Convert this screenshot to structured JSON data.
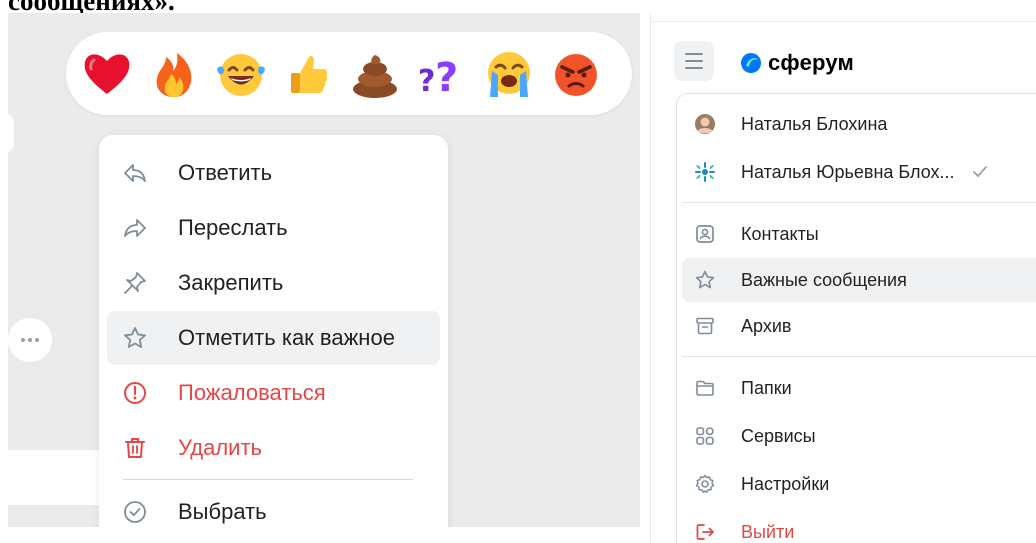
{
  "heading": {
    "text": "сообщениях»."
  },
  "reactions": [
    {
      "icon": "heart-emoji-icon"
    },
    {
      "icon": "fire-emoji-icon"
    },
    {
      "icon": "laughing-tears-emoji-icon"
    },
    {
      "icon": "thumbs-up-emoji-icon"
    },
    {
      "icon": "poop-emoji-icon"
    },
    {
      "icon": "question-marks-emoji-icon"
    },
    {
      "icon": "crying-face-emoji-icon"
    },
    {
      "icon": "angry-face-emoji-icon"
    }
  ],
  "context_menu": {
    "items": [
      {
        "label": "Ответить",
        "icon": "reply-icon"
      },
      {
        "label": "Переслать",
        "icon": "forward-icon"
      },
      {
        "label": "Закрепить",
        "icon": "pin-icon"
      },
      {
        "label": "Отметить как важное",
        "icon": "star-icon",
        "highlighted": true
      },
      {
        "label": "Пожаловаться",
        "icon": "report-icon",
        "danger": true
      },
      {
        "label": "Удалить",
        "icon": "trash-icon",
        "danger": true
      },
      {
        "label": "Выбрать",
        "icon": "check-circle-icon"
      }
    ]
  },
  "app": {
    "logo_text": "сферум"
  },
  "side_menu": {
    "accounts": [
      {
        "name": "Наталья Блохина",
        "icon": "user-avatar"
      },
      {
        "name": "Наталья Юрьевна Блох...",
        "icon": "organization-logo",
        "selected": true
      }
    ],
    "items": [
      {
        "label": "Контакты",
        "icon": "contacts-icon"
      },
      {
        "label": "Важные сообщения",
        "icon": "star-icon",
        "highlighted": true
      },
      {
        "label": "Архив",
        "icon": "archive-icon"
      },
      {
        "label": "Папки",
        "icon": "folder-icon"
      },
      {
        "label": "Сервисы",
        "icon": "services-icon"
      },
      {
        "label": "Настройки",
        "icon": "settings-icon"
      },
      {
        "label": "Выйти",
        "icon": "logout-icon",
        "danger": true
      }
    ]
  },
  "colors": {
    "accent": "#0077ff",
    "danger": "#e64646",
    "icon_gray": "#818c99",
    "highlight": "#f0f1f3",
    "backdrop": "#ebebeb"
  }
}
